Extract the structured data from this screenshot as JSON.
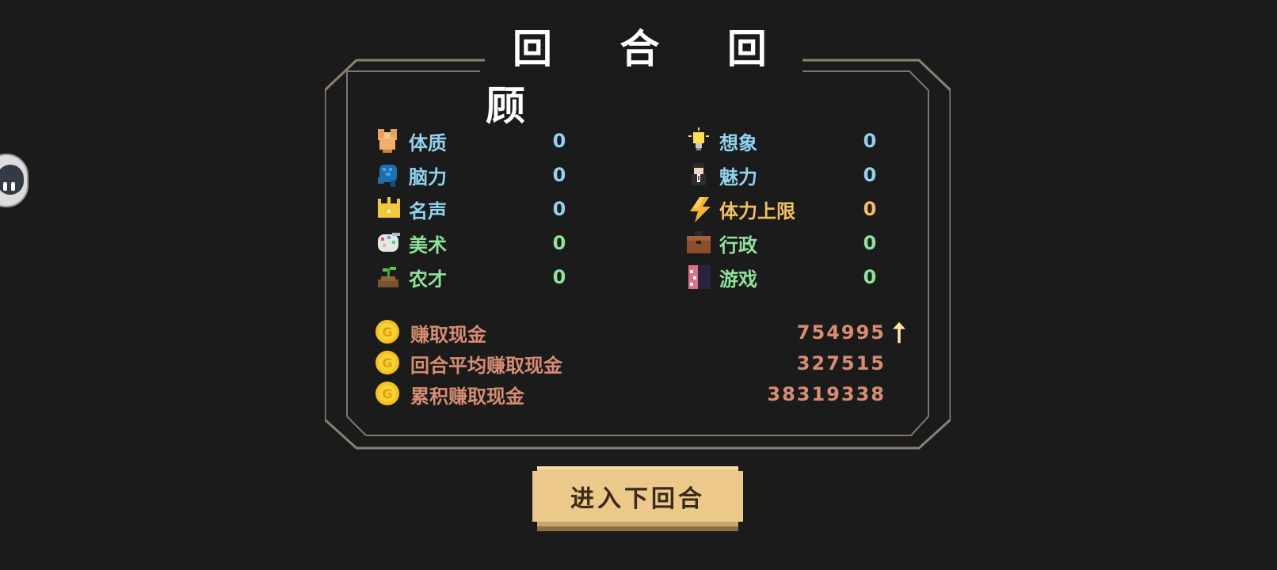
{
  "dialog": {
    "title": "回 合 回 顾",
    "stats_left": [
      {
        "id": "physique",
        "icon": "flexed-arm-icon",
        "label": "体质",
        "value": "0",
        "tone": "blue"
      },
      {
        "id": "brainpower",
        "icon": "brain-icon",
        "label": "脑力",
        "value": "0",
        "tone": "blue"
      },
      {
        "id": "fame",
        "icon": "crown-icon",
        "label": "名声",
        "value": "0",
        "tone": "blue"
      },
      {
        "id": "art",
        "icon": "palette-icon",
        "label": "美术",
        "value": "0",
        "tone": "green"
      },
      {
        "id": "farming",
        "icon": "sprout-icon",
        "label": "农才",
        "value": "0",
        "tone": "green"
      }
    ],
    "stats_right": [
      {
        "id": "imagination",
        "icon": "lightbulb-icon",
        "label": "想象",
        "value": "0",
        "tone": "blue"
      },
      {
        "id": "charm",
        "icon": "person-icon",
        "label": "魅力",
        "value": "0",
        "tone": "blue"
      },
      {
        "id": "stamina_cap",
        "icon": "lightning-icon",
        "label": "体力上限",
        "value": "0",
        "tone": "gold"
      },
      {
        "id": "admin",
        "icon": "briefcase-icon",
        "label": "行政",
        "value": "0",
        "tone": "green"
      },
      {
        "id": "games",
        "icon": "game-cartridge-icon",
        "label": "游戏",
        "value": "0",
        "tone": "green"
      }
    ],
    "money": [
      {
        "id": "earned",
        "icon": "coin-icon",
        "label": "赚取现金",
        "amount": "754995",
        "trend": "up-arrow-icon"
      },
      {
        "id": "average",
        "icon": "coin-icon",
        "label": "回合平均赚取现金",
        "amount": "327515"
      },
      {
        "id": "cumulative",
        "icon": "coin-icon",
        "label": "累积赚取现金",
        "amount": "38319338"
      }
    ],
    "next_button": "进入下回合"
  },
  "colors": {
    "background": "#1b1b1b",
    "frame": "#8c8170",
    "blue": "#8fd3ef",
    "gold": "#f3c25f",
    "green": "#8ee39a",
    "money": "#d88d73",
    "button": "#ecc88a"
  }
}
